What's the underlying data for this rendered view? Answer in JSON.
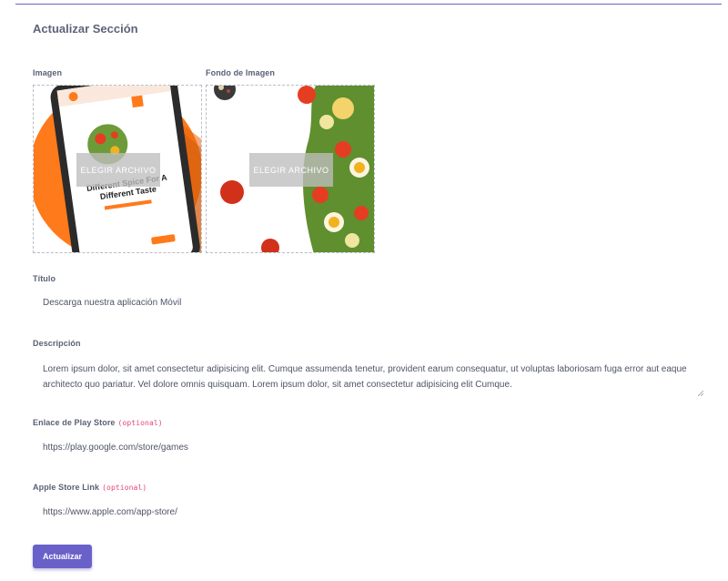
{
  "form": {
    "title": "Actualizar Sección",
    "image_label": "Imagen",
    "bg_image_label": "Fondo de Imagen",
    "image_choose": "ELEGIR ARCHIVO",
    "bg_choose": "ELEGIR ARCHIVO",
    "phone_headline_1": "Different Spice For A",
    "phone_headline_2": "Different Taste",
    "title_label": "Título",
    "title_value": "Descarga nuestra aplicación Móvil",
    "description_label": "Descripción",
    "description_value": "Lorem ipsum dolor, sit amet consectetur adipisicing elit. Cumque assumenda tenetur, provident earum consequatur, ut voluptas laboriosam fuga error aut eaque architecto quo pariatur. Vel dolore omnis quisquam. Lorem ipsum dolor, sit amet consectetur adipisicing elit Cumque.",
    "playstore_label": "Enlace de Play Store",
    "playstore_optional": "(optional)",
    "playstore_value": "https://play.google.com/store/games",
    "applestore_label": "Apple Store Link",
    "applestore_optional": "(optional)",
    "applestore_value": "https://www.apple.com/app-store/",
    "submit_label": "Actualizar"
  },
  "colors": {
    "accent": "#6a61c8",
    "optional_tag": "#e0457a",
    "phone_circle": "#ff7a1a"
  }
}
